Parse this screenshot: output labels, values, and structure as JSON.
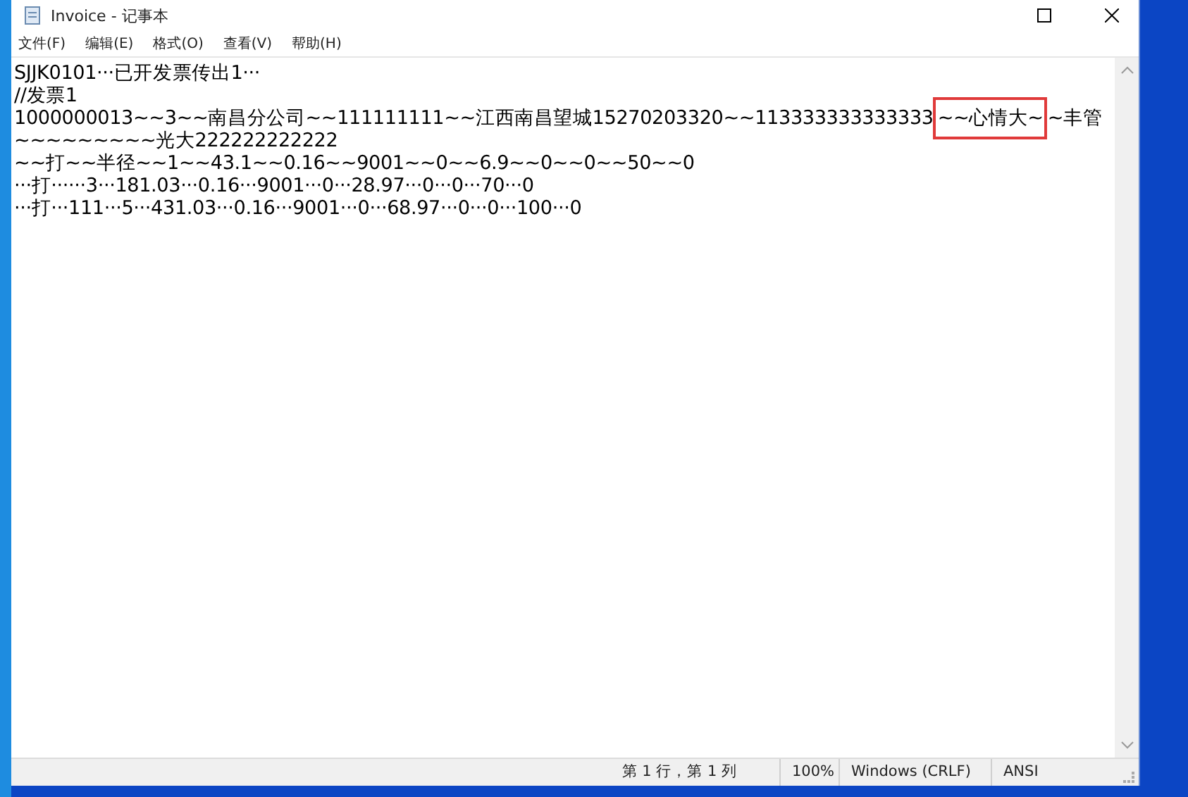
{
  "window": {
    "title": "Invoice - 记事本"
  },
  "menu": [
    "文件(F)",
    "编辑(E)",
    "格式(O)",
    "查看(V)",
    "帮助(H)"
  ],
  "lines": [
    {
      "segments": [
        {
          "text": "SJJK0101···已开发票传出1···",
          "boxed": false
        }
      ]
    },
    {
      "segments": [
        {
          "text": "//发票1",
          "boxed": false
        }
      ]
    },
    {
      "segments": [
        {
          "text": "1000000013~~3~~南昌分公司~~111111111~~江西南昌望城15270203320~~113333333333333",
          "boxed": false
        },
        {
          "text": "~~心情大~",
          "boxed": true
        },
        {
          "text": "~丰管",
          "boxed": false
        }
      ]
    },
    {
      "segments": [
        {
          "text": "~~~~~~~~~光大222222222222",
          "boxed": false
        }
      ]
    },
    {
      "segments": [
        {
          "text": "~~打~~半径~~1~~43.1~~0.16~~9001~~0~~6.9~~0~~0~~50~~0",
          "boxed": false
        }
      ]
    },
    {
      "segments": [
        {
          "text": "···打······3···181.03···0.16···9001···0···28.97···0···0···70···0",
          "boxed": false
        }
      ]
    },
    {
      "segments": [
        {
          "text": "···打···111···5···431.03···0.16···9001···0···68.97···0···0···100···0",
          "boxed": false
        }
      ]
    }
  ],
  "status_bar": [
    "第 1 行，第 1 列",
    "100%",
    "Windows (CRLF)",
    "ANSI"
  ]
}
